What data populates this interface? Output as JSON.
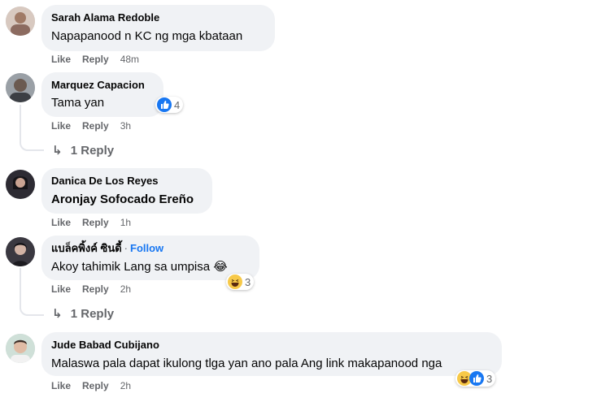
{
  "comments": [
    {
      "name": "Sarah Alama Redoble",
      "text": "Napapanood n KC ng mga kbataan",
      "like": "Like",
      "reply": "Reply",
      "time": "48m"
    },
    {
      "name": "Marquez Capacion",
      "text": "Tama yan",
      "like": "Like",
      "reply": "Reply",
      "time": "3h",
      "reaction_count": "4",
      "replies": "1 Reply"
    },
    {
      "name": "Danica De Los Reyes",
      "text": "Aronjay Sofocado Ereño",
      "like": "Like",
      "reply": "Reply",
      "time": "1h"
    },
    {
      "name": "แบล็คพิ้งค์ ซินดี้",
      "follow": "Follow",
      "text": "Akoy tahimik Lang sa umpisa 😂",
      "like": "Like",
      "reply": "Reply",
      "time": "2h",
      "reaction_count": "3",
      "replies": "1 Reply"
    },
    {
      "name": "Jude Babad Cubijano",
      "text": "Malaswa pala dapat ikulong tlga yan ano pala Ang link makapanood nga",
      "like": "Like",
      "reply": "Reply",
      "time": "2h",
      "reaction_count": "3"
    }
  ],
  "colors": {
    "bubble": "#f0f2f5",
    "meta": "#65676b",
    "accent": "#1877f2"
  },
  "icons": {
    "reply_arrow": "reply-arrow-icon",
    "like": "like-reaction-icon",
    "haha": "haha-reaction-icon"
  }
}
